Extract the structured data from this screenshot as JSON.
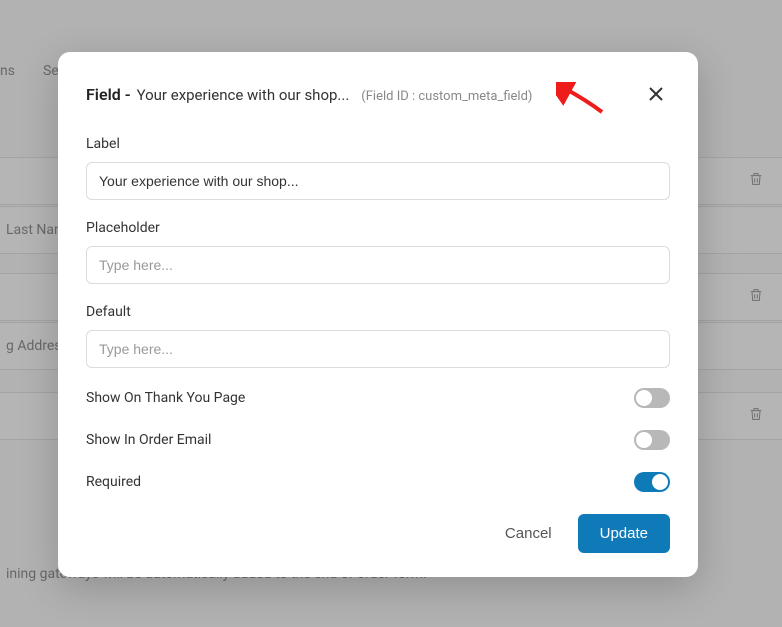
{
  "background": {
    "tabs": [
      "ns",
      "Se"
    ],
    "rows": {
      "row1_label": "",
      "row2_label": "Last Nam",
      "row3_label": "",
      "row4_label": "g Address",
      "row5_label": ""
    },
    "note": "ining gateways will be automatically added to the end of order form."
  },
  "modal": {
    "title_prefix": "Field -",
    "title_name": "Your experience with our shop...",
    "field_id_text": "(Field ID : custom_meta_field)",
    "fields": {
      "label": {
        "label": "Label",
        "value": "Your experience with our shop...",
        "placeholder": ""
      },
      "placeholder": {
        "label": "Placeholder",
        "value": "",
        "placeholder": "Type here..."
      },
      "default": {
        "label": "Default",
        "value": "",
        "placeholder": "Type here..."
      }
    },
    "toggles": {
      "thank_you": {
        "label": "Show On Thank You Page",
        "on": false
      },
      "order_email": {
        "label": "Show In Order Email",
        "on": false
      },
      "required": {
        "label": "Required",
        "on": true
      }
    },
    "buttons": {
      "cancel": "Cancel",
      "update": "Update"
    }
  }
}
